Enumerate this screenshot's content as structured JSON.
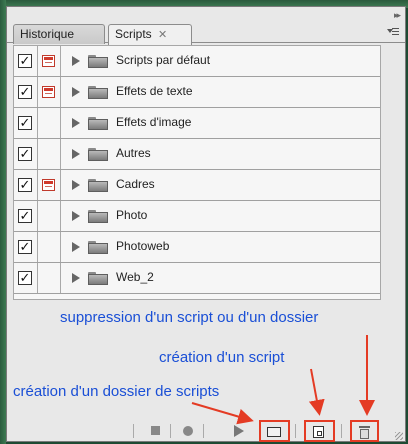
{
  "panel": {
    "tabs": [
      {
        "label": "Historique",
        "active": false
      },
      {
        "label": "Scripts",
        "active": true,
        "close_glyph": "✕"
      }
    ]
  },
  "scripts": [
    {
      "label": "Scripts par défaut",
      "checked": true,
      "dialog": true
    },
    {
      "label": "Effets de texte",
      "checked": true,
      "dialog": true
    },
    {
      "label": "Effets d'image",
      "checked": true,
      "dialog": false
    },
    {
      "label": "Autres",
      "checked": true,
      "dialog": false
    },
    {
      "label": "Cadres",
      "checked": true,
      "dialog": true
    },
    {
      "label": "Photo",
      "checked": true,
      "dialog": false
    },
    {
      "label": "Photoweb",
      "checked": true,
      "dialog": false
    },
    {
      "label": "Web_2",
      "checked": true,
      "dialog": false
    }
  ],
  "annotations": {
    "delete": "suppression d'un script ou d'un dossier",
    "new_script": "création d'un script",
    "new_set": "création d'un dossier de scripts"
  },
  "toolbar": {
    "buttons": [
      "stop-icon",
      "record-icon",
      "play-icon",
      "new-set-icon",
      "new-action-icon",
      "trash-icon"
    ]
  },
  "colors": {
    "annotation_text": "#1a4fd6",
    "highlight": "#e43b24",
    "dialog_toggle": "#c0392b"
  }
}
